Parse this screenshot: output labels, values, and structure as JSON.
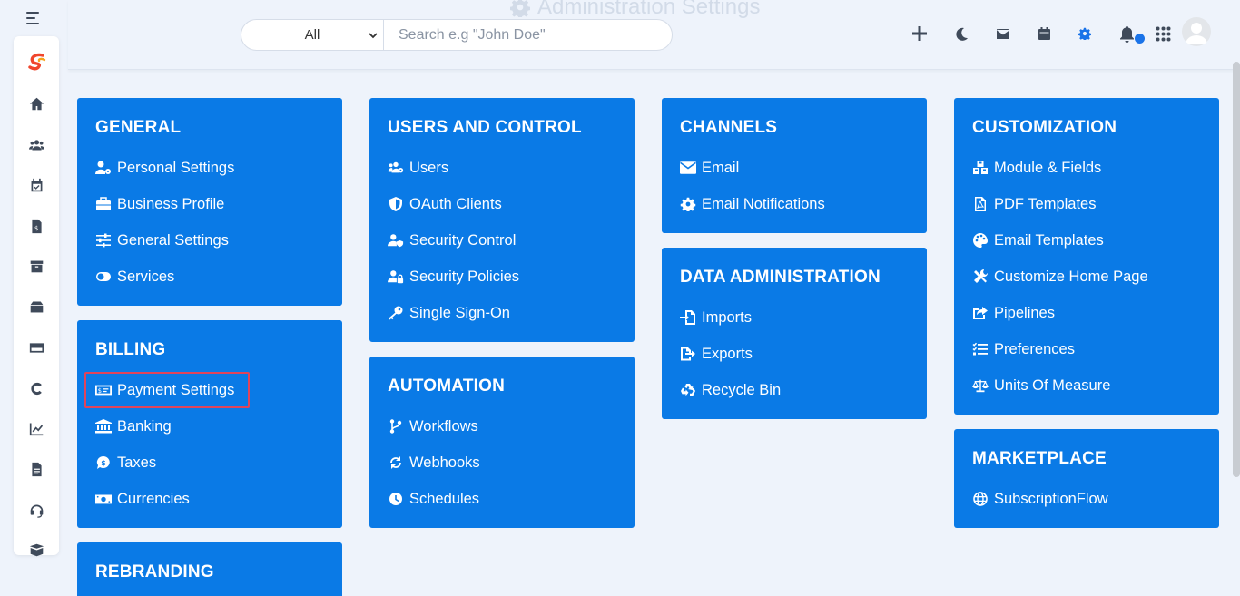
{
  "header": {
    "title": "Administration Settings",
    "search_scope": "All",
    "search_placeholder": "Search e.g \"John Doe\""
  },
  "icons": {
    "menu": "hamburger-icon",
    "logo": "app-logo",
    "add": "plus-icon",
    "theme": "moon-icon",
    "mail": "envelope-icon",
    "calendar": "calendar-icon",
    "settings": "gear-icon",
    "notifications": "bell-icon",
    "apps": "grid-icon",
    "avatar": "user-avatar"
  },
  "colors": {
    "card": "#0a7ae6",
    "accent": "#1a73e8",
    "highlight": "#e0445a"
  },
  "sections": {
    "general": {
      "title": "GENERAL",
      "items": [
        "Personal Settings",
        "Business Profile",
        "General Settings",
        "Services"
      ]
    },
    "billing": {
      "title": "BILLING",
      "items": [
        "Payment Settings",
        "Banking",
        "Taxes",
        "Currencies"
      ]
    },
    "rebranding": {
      "title": "REBRANDING"
    },
    "users": {
      "title": "USERS AND CONTROL",
      "items": [
        "Users",
        "OAuth Clients",
        "Security Control",
        "Security Policies",
        "Single Sign-On"
      ]
    },
    "automation": {
      "title": "AUTOMATION",
      "items": [
        "Workflows",
        "Webhooks",
        "Schedules"
      ]
    },
    "channels": {
      "title": "CHANNELS",
      "items": [
        "Email",
        "Email Notifications"
      ]
    },
    "data": {
      "title": "DATA ADMINISTRATION",
      "items": [
        "Imports",
        "Exports",
        "Recycle Bin"
      ]
    },
    "customization": {
      "title": "CUSTOMIZATION",
      "items": [
        "Module & Fields",
        "PDF Templates",
        "Email Templates",
        "Customize Home Page",
        "Pipelines",
        "Preferences",
        "Units Of Measure"
      ]
    },
    "marketplace": {
      "title": "MARKETPLACE",
      "items": [
        "SubscriptionFlow"
      ]
    }
  }
}
